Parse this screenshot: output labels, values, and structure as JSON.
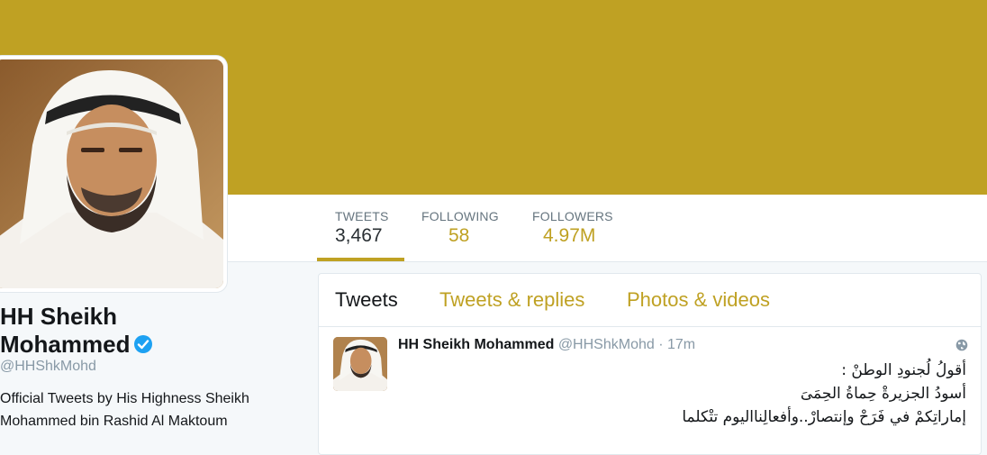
{
  "profile": {
    "name_line1": "HH Sheikh",
    "name_line2": "Mohammed",
    "handle": "@HHShkMohd",
    "bio": "Official Tweets by His Highness Sheikh Mohammed bin Rashid Al Maktoum",
    "verified": true
  },
  "stats": [
    {
      "label": "TWEETS",
      "value": "3,467"
    },
    {
      "label": "FOLLOWING",
      "value": "58"
    },
    {
      "label": "FOLLOWERS",
      "value": "4.97M"
    }
  ],
  "tabs": [
    {
      "label": "Tweets"
    },
    {
      "label": "Tweets & replies"
    },
    {
      "label": "Photos & videos"
    }
  ],
  "tweet": {
    "name": "HH Sheikh Mohammed",
    "handle": "@HHShkMohd",
    "separator": "·",
    "time": "17m",
    "lines": [
      "أقولُ لُجنودِ الوطنْ :",
      "أسودُ الجزيرةْ حِماةُ الحِمَىَ",
      "إماراتِكمْ في فَرَحْ وإنتصارْ..وأفعالِنااليوم تتْكلما"
    ]
  },
  "colors": {
    "accent": "#bfa123",
    "verified": "#1da1f2",
    "banner": "#bfa123"
  },
  "icons": [
    "verified-icon",
    "globe-icon"
  ]
}
